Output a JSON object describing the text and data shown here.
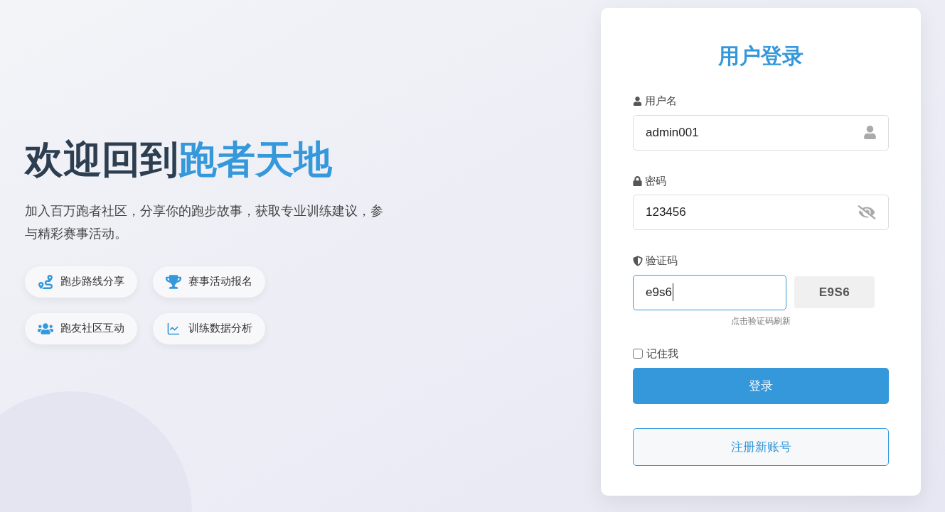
{
  "hero": {
    "title_part_1": "欢迎回到",
    "title_part_2": "跑者天地",
    "description": "加入百万跑者社区，分享你的跑步故事，获取专业训练建议，参与精彩赛事活动。",
    "features": [
      {
        "kind": "route",
        "label": "跑步路线分享"
      },
      {
        "kind": "trophy",
        "label": "赛事活动报名"
      },
      {
        "kind": "people",
        "label": "跑友社区互动"
      },
      {
        "kind": "chart",
        "label": "训练数据分析"
      }
    ]
  },
  "login": {
    "title": "用户登录",
    "username": {
      "label": "用户名",
      "value": "admin001"
    },
    "password": {
      "label": "密码",
      "value": "123456"
    },
    "captcha": {
      "label": "验证码",
      "value": "e9s6",
      "focused": true,
      "code": "E9S6",
      "hint": "点击验证码刷新"
    },
    "remember": {
      "label": "记住我",
      "checked": false
    },
    "login_button": "登录",
    "register_button": "注册新账号"
  }
}
